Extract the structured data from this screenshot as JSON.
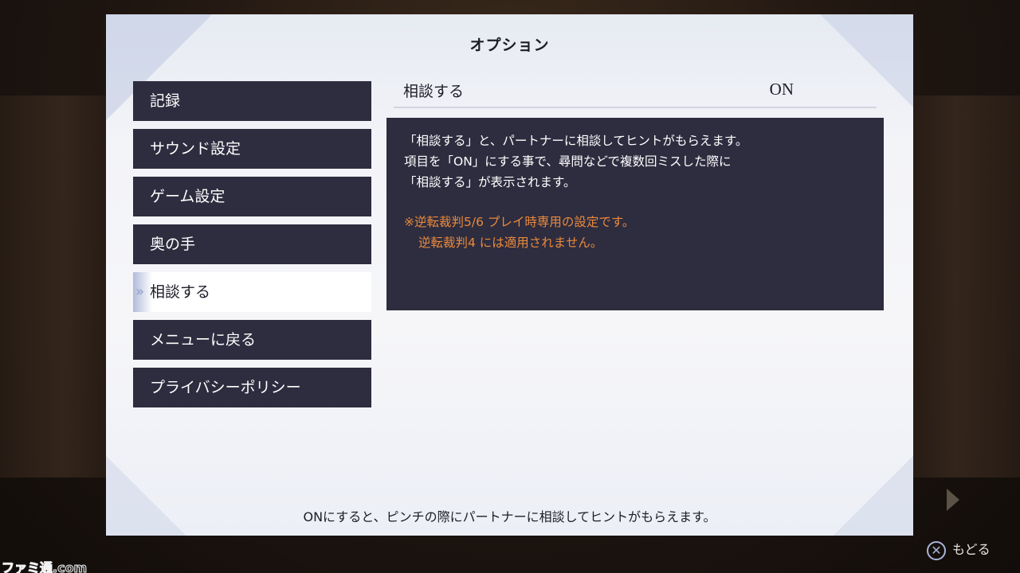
{
  "panel": {
    "title": "オプション"
  },
  "menu": {
    "items": [
      {
        "label": "記録"
      },
      {
        "label": "サウンド設定"
      },
      {
        "label": "ゲーム設定"
      },
      {
        "label": "奥の手"
      },
      {
        "label": "相談する",
        "selected": true
      },
      {
        "label": "メニューに戻る"
      },
      {
        "label": "プライバシーポリシー"
      }
    ]
  },
  "setting": {
    "label": "相談する",
    "value": "ON"
  },
  "description": {
    "lines": [
      "「相談する」と、パートナーに相談してヒントがもらえます。",
      "項目を「ON」にする事で、尋問などで複数回ミスした際に",
      "「相談する」が表示されます。"
    ],
    "note_lines": [
      "※逆転裁判5/6 プレイ時専用の設定です。",
      "逆転裁判4 には適用されません。"
    ]
  },
  "help_text": "ONにすると、ピンチの際にパートナーに相談してヒントがもらえます。",
  "back": {
    "icon": "cross-button-icon",
    "label": "もどる"
  },
  "watermark": "ファミ通.com",
  "colors": {
    "menu_bg": "#2e2c3f",
    "selected_bg": "#ffffff",
    "note": "#e88a3c"
  }
}
